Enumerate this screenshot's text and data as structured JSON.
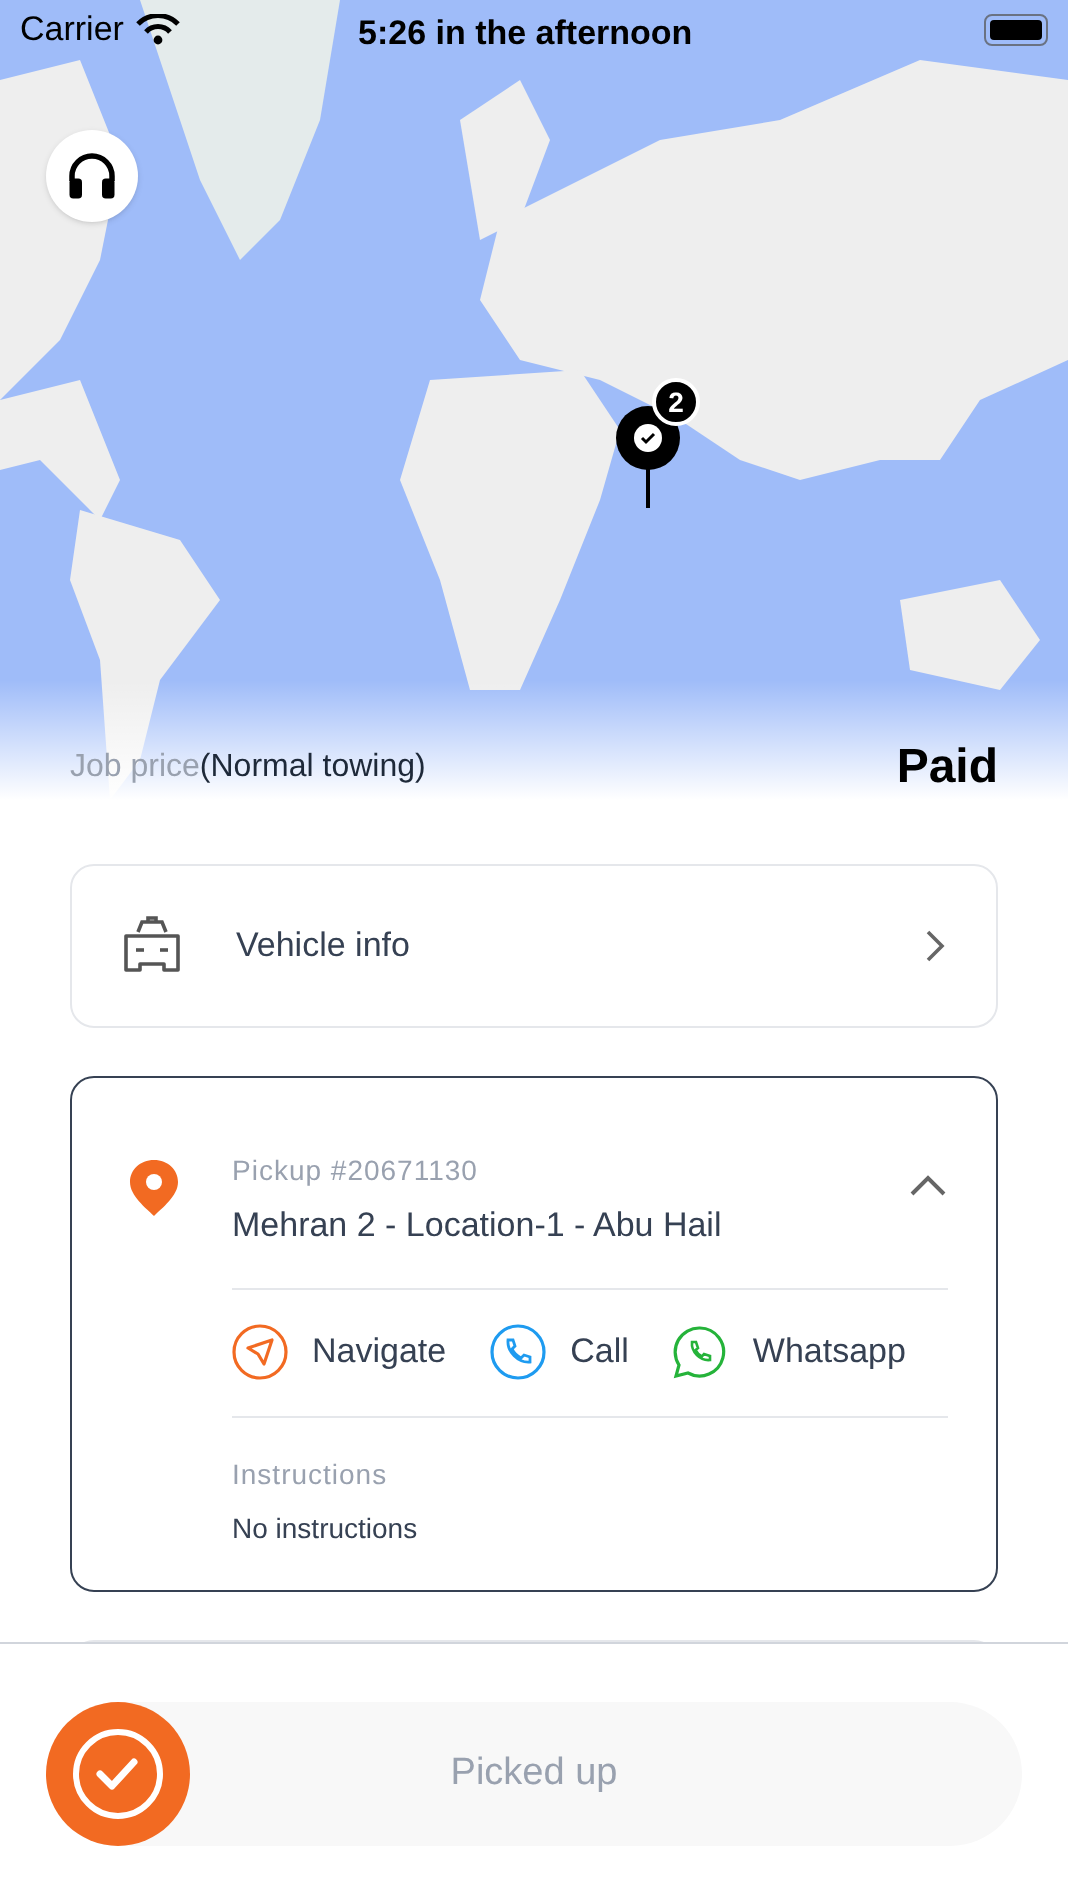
{
  "status_bar": {
    "carrier": "Carrier",
    "time": "5:26 in the afternoon"
  },
  "map": {
    "cluster_count": "2"
  },
  "job": {
    "label": "Job price",
    "service": "(Normal towing)",
    "payment": "Paid"
  },
  "vehicle_info": {
    "label": "Vehicle info"
  },
  "pickup": {
    "title": "Pickup #20671130",
    "address": "Mehran 2 - Location-1 - Abu Hail",
    "expanded": true,
    "actions": [
      {
        "kind": "navigate",
        "label": "Navigate"
      },
      {
        "kind": "call",
        "label": "Call"
      },
      {
        "kind": "whatsapp",
        "label": "Whatsapp"
      }
    ],
    "instructions_label": "Instructions",
    "instructions": "No instructions"
  },
  "slider": {
    "label": "Picked up",
    "level": 0
  }
}
